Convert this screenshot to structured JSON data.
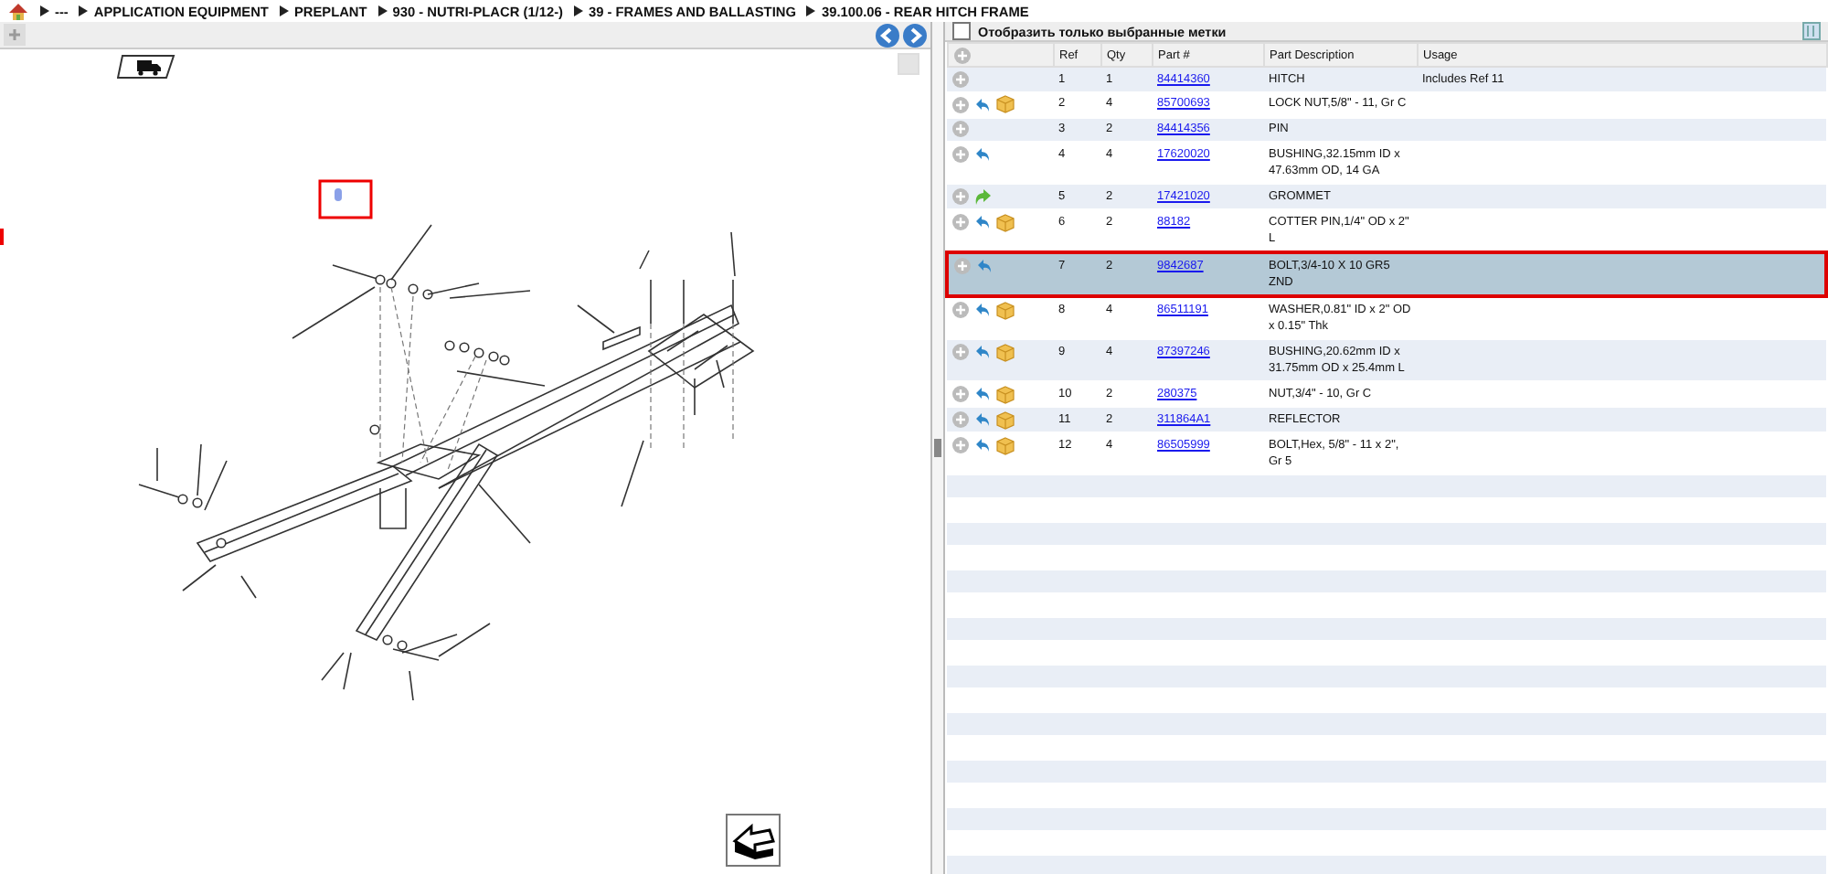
{
  "breadcrumb": [
    "---",
    "APPLICATION EQUIPMENT",
    "PREPLANT",
    "930 - NUTRI-PLACR (1/12-)",
    "39 - FRAMES AND BALLASTING",
    "39.100.06 - REAR HITCH FRAME"
  ],
  "filter": {
    "label": "Отобразить только выбранные метки",
    "checked": false
  },
  "table": {
    "columns": [
      "Ref",
      "Qty",
      "Part #",
      "Part Description",
      "Usage"
    ],
    "rows": [
      {
        "return_arrow": false,
        "forward_arrow": false,
        "box": false,
        "ref": "1",
        "qty": "1",
        "part": "84414360",
        "description": "HITCH",
        "usage": "Includes Ref 11",
        "selected": false
      },
      {
        "return_arrow": true,
        "forward_arrow": false,
        "box": true,
        "ref": "2",
        "qty": "4",
        "part": "85700693",
        "description": "LOCK NUT,5/8\" - 11, Gr C",
        "selected": false
      },
      {
        "return_arrow": false,
        "forward_arrow": false,
        "box": false,
        "ref": "3",
        "qty": "2",
        "part": "84414356",
        "description": "PIN",
        "selected": false
      },
      {
        "return_arrow": true,
        "forward_arrow": false,
        "box": false,
        "ref": "4",
        "qty": "4",
        "part": "17620020",
        "description": "BUSHING,32.15mm ID x 47.63mm OD, 14 GA",
        "selected": false
      },
      {
        "return_arrow": false,
        "forward_arrow": true,
        "box": false,
        "ref": "5",
        "qty": "2",
        "part": "17421020",
        "description": "GROMMET",
        "selected": false
      },
      {
        "return_arrow": true,
        "forward_arrow": false,
        "box": true,
        "ref": "6",
        "qty": "2",
        "part": "88182",
        "description": "COTTER PIN,1/4\" OD x 2\" L",
        "selected": false
      },
      {
        "return_arrow": true,
        "forward_arrow": false,
        "box": false,
        "ref": "7",
        "qty": "2",
        "part": "9842687",
        "description": "BOLT,3/4-10 X 10 GR5 ZND",
        "selected": true
      },
      {
        "return_arrow": true,
        "forward_arrow": false,
        "box": true,
        "ref": "8",
        "qty": "4",
        "part": "86511191",
        "description": "WASHER,0.81\" ID x 2\" OD x 0.15\" Thk",
        "selected": false
      },
      {
        "return_arrow": true,
        "forward_arrow": false,
        "box": true,
        "ref": "9",
        "qty": "4",
        "part": "87397246",
        "description": "BUSHING,20.62mm ID x 31.75mm OD x 25.4mm L",
        "selected": false
      },
      {
        "return_arrow": true,
        "forward_arrow": false,
        "box": true,
        "ref": "10",
        "qty": "2",
        "part": "280375",
        "description": "NUT,3/4\" - 10, Gr C",
        "selected": false
      },
      {
        "return_arrow": true,
        "forward_arrow": false,
        "box": true,
        "ref": "11",
        "qty": "2",
        "part": "311864A1",
        "description": "REFLECTOR",
        "selected": false
      },
      {
        "return_arrow": true,
        "forward_arrow": false,
        "box": true,
        "ref": "12",
        "qty": "4",
        "part": "86505999",
        "description": "BOLT,Hex, 5/8\" - 11 x 2\", Gr 5",
        "selected": false
      }
    ]
  }
}
